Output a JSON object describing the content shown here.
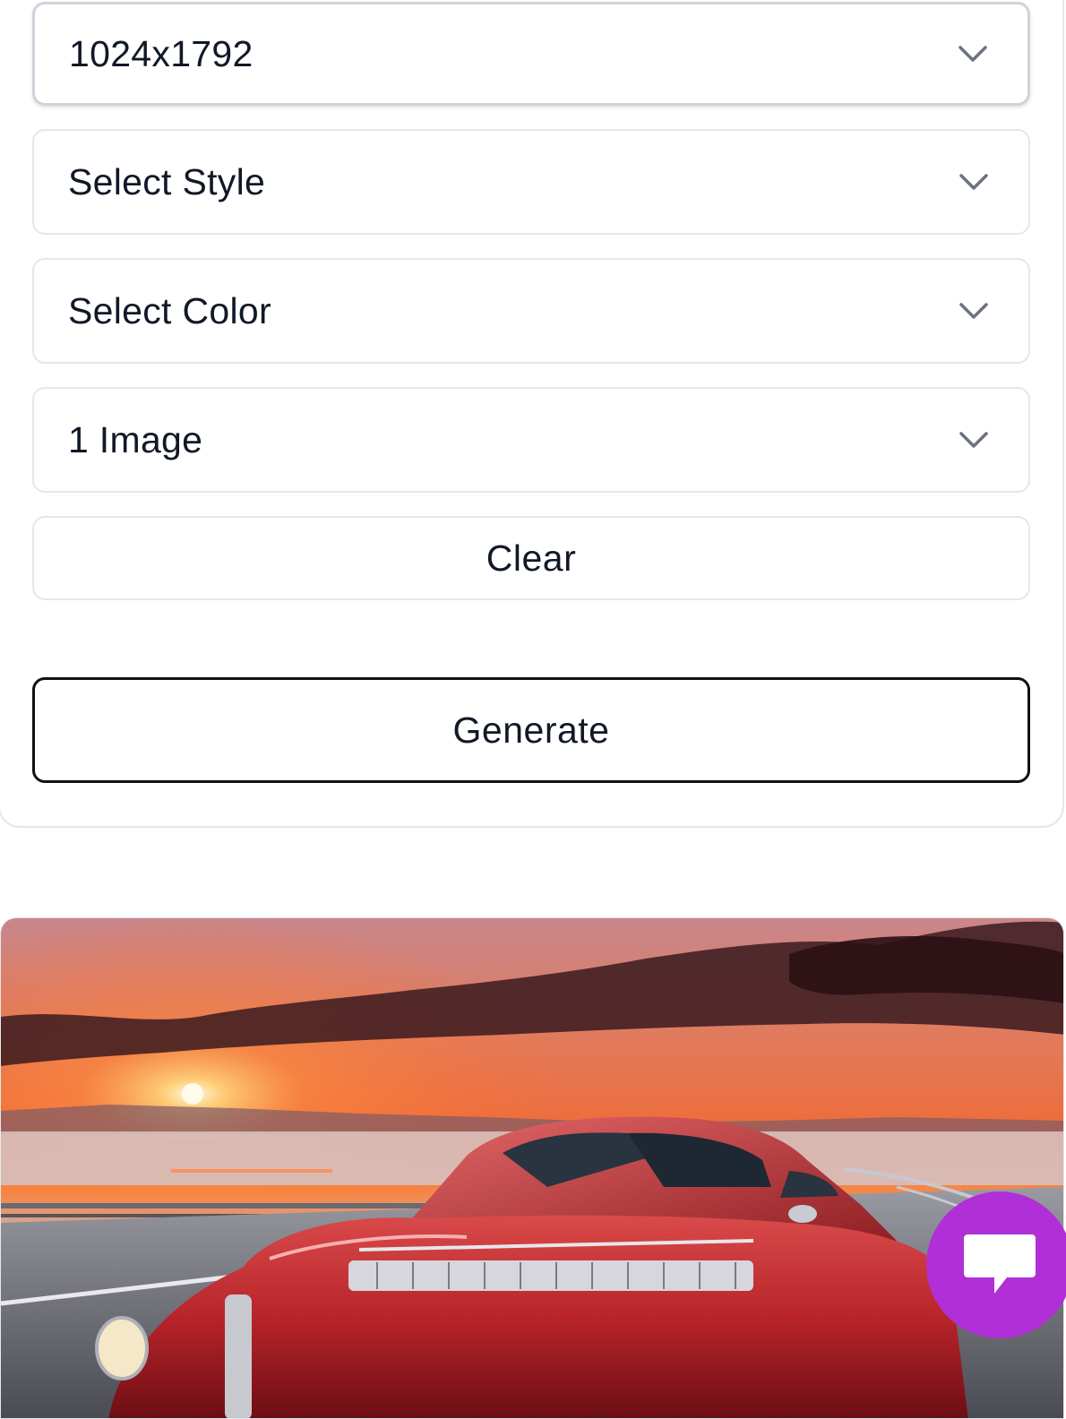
{
  "form": {
    "size_select": {
      "value": "1024x1792"
    },
    "style_select": {
      "value": "Select Style"
    },
    "color_select": {
      "value": "Select Color"
    },
    "count_select": {
      "value": "1 Image"
    },
    "clear_label": "Clear",
    "generate_label": "Generate"
  },
  "result": {
    "image_subject": "red-vintage-car-sunset-highway"
  },
  "chat": {
    "icon": "chat-bubble-icon",
    "accent": "#b12fd6"
  }
}
